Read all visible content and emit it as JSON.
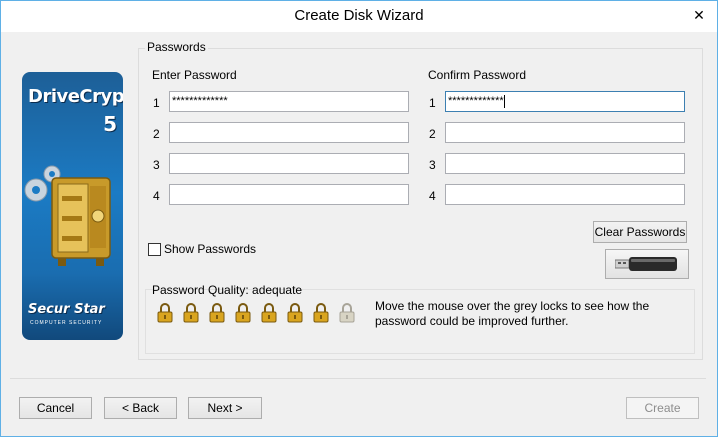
{
  "window": {
    "title": "Create Disk Wizard"
  },
  "logo": {
    "product": "DriveCrypt",
    "version": "5",
    "brand": "Secur Star",
    "tagline": "COMPUTER SECURITY"
  },
  "passwords": {
    "group_label": "Passwords",
    "enter_header": "Enter Password",
    "confirm_header": "Confirm Password",
    "rows": [
      {
        "num": "1",
        "enter_value": "*************",
        "confirm_value": "*************"
      },
      {
        "num": "2",
        "enter_value": "",
        "confirm_value": ""
      },
      {
        "num": "3",
        "enter_value": "",
        "confirm_value": ""
      },
      {
        "num": "4",
        "enter_value": "",
        "confirm_value": ""
      }
    ],
    "show_passwords_label": "Show Passwords",
    "show_passwords_checked": false,
    "clear_label": "Clear Passwords"
  },
  "quality": {
    "label": "Password Quality: adequate",
    "locks_total": 8,
    "locks_active": 7,
    "hint": "Move the mouse over the grey locks to see how the password could be improved further."
  },
  "footer": {
    "cancel_label": "Cancel",
    "back_label": "< Back",
    "next_label": "Next >",
    "create_label": "Create",
    "create_enabled": false
  },
  "colors": {
    "lock_gold": "#d9a520",
    "lock_grey": "#d8d4c4",
    "logo_blue": "#1b7bc4"
  }
}
